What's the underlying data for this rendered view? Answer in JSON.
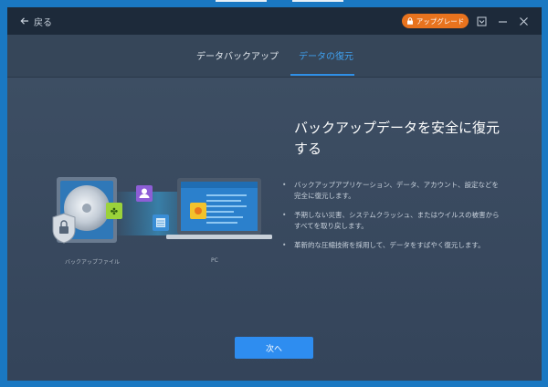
{
  "titlebar": {
    "back_label": "戻る",
    "upgrade_label": "アップグレード"
  },
  "tabs": [
    {
      "label": "データバックアップ",
      "active": false
    },
    {
      "label": "データの復元",
      "active": true
    }
  ],
  "main": {
    "heading": "バックアップデータを安全に復元する",
    "bullets": [
      "バックアップアプリケーション、データ、アカウント、設定などを完全に復元します。",
      "予期しない災害、システムクラッシュ、またはウイルスの被害からすべてを取り戻します。",
      "革新的な圧縮技術を採用して、データをすばやく復元します。"
    ],
    "next_label": "次へ"
  },
  "illustration": {
    "source_caption": "バックアップファイル",
    "target_caption": "PC"
  },
  "colors": {
    "accent": "#2e8df0",
    "upgrade": "#e8731e",
    "titlebar": "#1d2a3a",
    "background": "#3a4a5e"
  },
  "icons": [
    "back-arrow-icon",
    "lock-icon",
    "menu-icon",
    "minimize-icon",
    "close-icon"
  ]
}
